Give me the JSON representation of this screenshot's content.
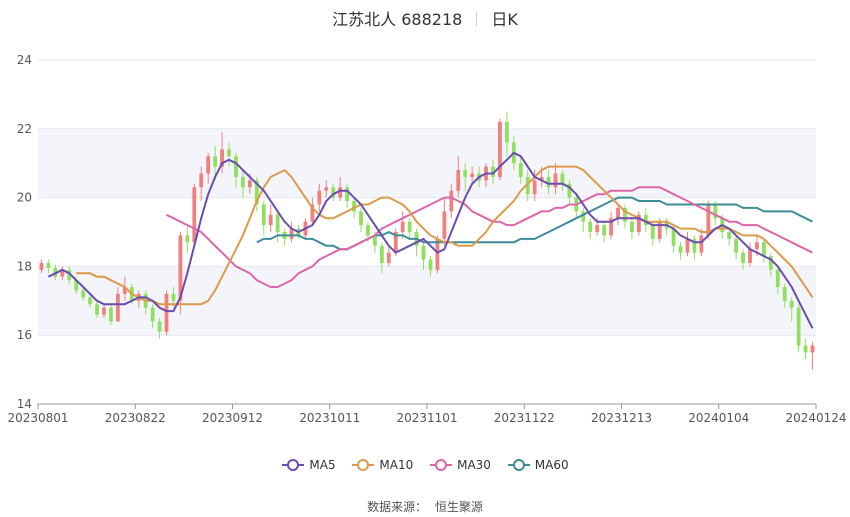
{
  "title": {
    "name": "江苏北人 688218",
    "period": "日K"
  },
  "source": {
    "label": "数据来源：",
    "provider": "恒生聚源"
  },
  "chart_data": {
    "type": "candlestick",
    "ylim": [
      14,
      24
    ],
    "yticks": [
      "14",
      "16",
      "18",
      "20",
      "22",
      "24"
    ],
    "xticks": [
      "20230801",
      "20230822",
      "20230912",
      "20231011",
      "20231101",
      "20231122",
      "20231213",
      "20240104",
      "20240124"
    ],
    "up_color": "#f08080",
    "down_color": "#90e060",
    "grid_band_color": "#f3f5fa",
    "legend": [
      {
        "name": "MA5",
        "color": "#6b4cb0"
      },
      {
        "name": "MA10",
        "color": "#dd9a4a"
      },
      {
        "name": "MA30",
        "color": "#dd66aa"
      },
      {
        "name": "MA60",
        "color": "#3c8e96"
      }
    ],
    "candles": [
      [
        17.9,
        18.1,
        17.8,
        18.2
      ],
      [
        18.1,
        17.95,
        17.8,
        18.2
      ],
      [
        17.95,
        17.7,
        17.6,
        18.05
      ],
      [
        17.7,
        17.9,
        17.6,
        18.0
      ],
      [
        17.9,
        17.6,
        17.5,
        18.0
      ],
      [
        17.6,
        17.3,
        17.2,
        17.7
      ],
      [
        17.3,
        17.1,
        17.0,
        17.4
      ],
      [
        17.1,
        16.9,
        16.8,
        17.2
      ],
      [
        16.9,
        16.6,
        16.5,
        17.0
      ],
      [
        16.6,
        16.8,
        16.5,
        16.9
      ],
      [
        16.8,
        16.4,
        16.3,
        16.9
      ],
      [
        16.4,
        17.2,
        16.4,
        17.4
      ],
      [
        17.2,
        17.4,
        17.0,
        17.7
      ],
      [
        17.4,
        17.0,
        16.9,
        17.5
      ],
      [
        17.0,
        17.2,
        16.8,
        17.3
      ],
      [
        17.2,
        16.8,
        16.6,
        17.3
      ],
      [
        16.8,
        16.4,
        16.2,
        16.9
      ],
      [
        16.4,
        16.1,
        15.9,
        16.5
      ],
      [
        16.1,
        17.2,
        16.0,
        17.3
      ],
      [
        17.2,
        17.0,
        16.8,
        17.4
      ],
      [
        17.0,
        18.9,
        16.6,
        19.0
      ],
      [
        18.9,
        18.7,
        18.4,
        19.2
      ],
      [
        18.7,
        20.3,
        18.6,
        20.4
      ],
      [
        20.3,
        20.7,
        19.9,
        20.9
      ],
      [
        20.7,
        21.2,
        20.4,
        21.3
      ],
      [
        21.2,
        20.9,
        20.5,
        21.5
      ],
      [
        20.9,
        21.4,
        20.7,
        21.9
      ],
      [
        21.4,
        21.2,
        20.9,
        21.6
      ],
      [
        21.2,
        20.6,
        20.3,
        21.3
      ],
      [
        20.6,
        20.3,
        20.0,
        20.8
      ],
      [
        20.3,
        20.5,
        20.1,
        20.7
      ],
      [
        20.5,
        19.8,
        19.6,
        20.6
      ],
      [
        19.8,
        19.2,
        18.9,
        19.9
      ],
      [
        19.2,
        19.5,
        19.0,
        19.8
      ],
      [
        19.5,
        19.0,
        18.7,
        19.6
      ],
      [
        19.0,
        18.8,
        18.6,
        19.1
      ],
      [
        18.8,
        19.1,
        18.7,
        19.3
      ],
      [
        19.1,
        18.9,
        18.8,
        19.2
      ],
      [
        18.9,
        19.3,
        18.8,
        19.4
      ],
      [
        19.3,
        19.8,
        19.2,
        20.0
      ],
      [
        19.8,
        20.2,
        19.6,
        20.4
      ],
      [
        20.2,
        20.3,
        20.0,
        20.5
      ],
      [
        20.3,
        20.0,
        19.9,
        20.4
      ],
      [
        20.0,
        20.3,
        19.9,
        20.6
      ],
      [
        20.3,
        19.9,
        19.7,
        20.4
      ],
      [
        19.9,
        19.6,
        19.4,
        20.0
      ],
      [
        19.6,
        19.2,
        19.0,
        19.7
      ],
      [
        19.2,
        18.9,
        18.7,
        19.3
      ],
      [
        18.9,
        18.6,
        18.4,
        19.0
      ],
      [
        18.6,
        18.1,
        17.8,
        18.7
      ],
      [
        18.1,
        18.4,
        18.0,
        18.6
      ],
      [
        18.4,
        19.0,
        18.3,
        19.1
      ],
      [
        19.0,
        19.3,
        18.8,
        19.6
      ],
      [
        19.3,
        19.0,
        18.8,
        19.4
      ],
      [
        19.0,
        18.6,
        18.3,
        19.1
      ],
      [
        18.6,
        18.2,
        17.9,
        18.7
      ],
      [
        18.2,
        17.9,
        17.7,
        18.3
      ],
      [
        17.9,
        18.8,
        17.8,
        18.9
      ],
      [
        18.8,
        19.6,
        18.6,
        20.0
      ],
      [
        19.6,
        20.2,
        19.4,
        20.4
      ],
      [
        20.2,
        20.8,
        20.0,
        21.2
      ],
      [
        20.8,
        20.6,
        20.2,
        21.0
      ],
      [
        20.6,
        20.7,
        20.4,
        20.9
      ],
      [
        20.7,
        20.5,
        20.3,
        20.9
      ],
      [
        20.5,
        20.9,
        20.3,
        21.0
      ],
      [
        20.9,
        20.6,
        20.4,
        21.1
      ],
      [
        20.6,
        22.2,
        20.5,
        22.3
      ],
      [
        22.2,
        21.6,
        21.2,
        22.5
      ],
      [
        21.6,
        21.0,
        20.8,
        21.8
      ],
      [
        21.0,
        20.6,
        20.4,
        21.2
      ],
      [
        20.6,
        20.1,
        19.9,
        20.8
      ],
      [
        20.1,
        20.5,
        19.9,
        20.8
      ],
      [
        20.5,
        20.6,
        20.3,
        20.9
      ],
      [
        20.6,
        20.3,
        20.1,
        20.8
      ],
      [
        20.3,
        20.7,
        20.1,
        21.0
      ],
      [
        20.7,
        20.4,
        20.2,
        20.8
      ],
      [
        20.4,
        20.0,
        19.8,
        20.5
      ],
      [
        20.0,
        19.6,
        19.4,
        20.1
      ],
      [
        19.6,
        19.3,
        19.0,
        19.7
      ],
      [
        19.3,
        19.0,
        18.8,
        19.4
      ],
      [
        19.0,
        19.2,
        18.9,
        19.4
      ],
      [
        19.2,
        18.9,
        18.7,
        19.3
      ],
      [
        18.9,
        19.4,
        18.8,
        19.6
      ],
      [
        19.4,
        19.7,
        19.2,
        19.8
      ],
      [
        19.7,
        19.3,
        19.1,
        19.8
      ],
      [
        19.3,
        19.0,
        18.8,
        19.4
      ],
      [
        19.0,
        19.5,
        18.9,
        19.6
      ],
      [
        19.5,
        19.2,
        19.0,
        19.7
      ],
      [
        19.2,
        18.8,
        18.6,
        19.3
      ],
      [
        18.8,
        19.3,
        18.7,
        19.4
      ],
      [
        19.3,
        19.1,
        18.9,
        19.4
      ],
      [
        19.1,
        18.6,
        18.4,
        19.2
      ],
      [
        18.6,
        18.4,
        18.2,
        18.7
      ],
      [
        18.4,
        18.8,
        18.3,
        19.0
      ],
      [
        18.8,
        18.4,
        18.2,
        18.9
      ],
      [
        18.4,
        18.9,
        18.3,
        19.1
      ],
      [
        18.9,
        19.8,
        18.8,
        19.9
      ],
      [
        19.8,
        19.4,
        19.2,
        19.9
      ],
      [
        19.4,
        19.0,
        18.8,
        19.5
      ],
      [
        19.0,
        18.8,
        18.6,
        19.1
      ],
      [
        18.8,
        18.4,
        18.2,
        18.9
      ],
      [
        18.4,
        18.1,
        17.9,
        18.5
      ],
      [
        18.1,
        18.5,
        18.0,
        18.7
      ],
      [
        18.5,
        18.7,
        18.3,
        18.9
      ],
      [
        18.7,
        18.3,
        18.1,
        18.8
      ],
      [
        18.3,
        17.9,
        17.7,
        18.4
      ],
      [
        17.9,
        17.4,
        17.2,
        18.0
      ],
      [
        17.4,
        17.0,
        16.8,
        17.5
      ],
      [
        17.0,
        16.8,
        16.4,
        17.1
      ],
      [
        16.8,
        15.7,
        15.5,
        16.9
      ],
      [
        15.7,
        15.5,
        15.3,
        15.9
      ],
      [
        15.5,
        15.7,
        15.0,
        15.8
      ]
    ],
    "ma5": [
      17.7,
      17.8,
      17.9,
      17.8,
      17.6,
      17.4,
      17.2,
      17.0,
      16.9,
      16.9,
      16.9,
      16.9,
      17.0,
      17.1,
      17.1,
      17.0,
      16.8,
      16.7,
      16.7,
      17.1,
      17.8,
      18.6,
      19.4,
      20.1,
      20.6,
      21.0,
      21.1,
      21.0,
      20.8,
      20.6,
      20.4,
      20.2,
      19.9,
      19.6,
      19.3,
      19.1,
      19.0,
      19.1,
      19.2,
      19.5,
      19.9,
      20.1,
      20.2,
      20.2,
      20.0,
      19.8,
      19.5,
      19.2,
      18.9,
      18.6,
      18.4,
      18.5,
      18.6,
      18.7,
      18.8,
      18.6,
      18.4,
      18.5,
      19.0,
      19.5,
      20.0,
      20.4,
      20.6,
      20.7,
      20.7,
      20.9,
      21.1,
      21.3,
      21.2,
      20.9,
      20.6,
      20.5,
      20.4,
      20.4,
      20.4,
      20.3,
      20.1,
      19.8,
      19.5,
      19.3,
      19.3,
      19.3,
      19.4,
      19.4,
      19.4,
      19.4,
      19.3,
      19.2,
      19.2,
      19.2,
      19.1,
      18.9,
      18.8,
      18.7,
      18.7,
      18.9,
      19.1,
      19.2,
      19.1,
      18.9,
      18.7,
      18.5,
      18.4,
      18.3,
      18.2,
      18.0,
      17.7,
      17.4,
      17.0,
      16.6,
      16.2
    ],
    "ma10": [
      17.8,
      17.8,
      17.8,
      17.7,
      17.7,
      17.6,
      17.5,
      17.4,
      17.2,
      17.1,
      17.0,
      17.0,
      16.9,
      16.9,
      16.9,
      16.9,
      16.9,
      16.9,
      16.9,
      17.0,
      17.3,
      17.7,
      18.1,
      18.5,
      18.9,
      19.4,
      19.9,
      20.3,
      20.6,
      20.7,
      20.8,
      20.6,
      20.3,
      20.0,
      19.7,
      19.5,
      19.4,
      19.4,
      19.5,
      19.6,
      19.7,
      19.8,
      19.8,
      19.9,
      20.0,
      20.0,
      19.9,
      19.8,
      19.6,
      19.3,
      19.1,
      18.9,
      18.8,
      18.7,
      18.7,
      18.6,
      18.6,
      18.6,
      18.8,
      19.0,
      19.3,
      19.5,
      19.7,
      19.9,
      20.2,
      20.4,
      20.6,
      20.8,
      20.9,
      20.9,
      20.9,
      20.9,
      20.9,
      20.8,
      20.6,
      20.4,
      20.2,
      20.0,
      19.8,
      19.6,
      19.5,
      19.4,
      19.3,
      19.3,
      19.3,
      19.3,
      19.2,
      19.1,
      19.1,
      19.1,
      19.0,
      19.0,
      19.1,
      19.1,
      19.1,
      19.0,
      18.9,
      18.9,
      18.9,
      18.8,
      18.6,
      18.4,
      18.2,
      18.0,
      17.7,
      17.4,
      17.1
    ],
    "ma30": [
      19.5,
      19.4,
      19.3,
      19.2,
      19.1,
      19.0,
      18.8,
      18.6,
      18.4,
      18.2,
      18.0,
      17.9,
      17.8,
      17.6,
      17.5,
      17.4,
      17.4,
      17.5,
      17.6,
      17.8,
      17.9,
      18.0,
      18.2,
      18.3,
      18.4,
      18.5,
      18.5,
      18.6,
      18.7,
      18.8,
      18.9,
      19.1,
      19.2,
      19.3,
      19.4,
      19.5,
      19.6,
      19.7,
      19.8,
      19.9,
      20.0,
      20.0,
      19.9,
      19.8,
      19.6,
      19.5,
      19.4,
      19.3,
      19.3,
      19.2,
      19.2,
      19.3,
      19.4,
      19.5,
      19.6,
      19.6,
      19.7,
      19.7,
      19.8,
      19.8,
      19.9,
      20.0,
      20.1,
      20.1,
      20.2,
      20.2,
      20.2,
      20.2,
      20.3,
      20.3,
      20.3,
      20.3,
      20.2,
      20.1,
      20.0,
      19.9,
      19.8,
      19.7,
      19.6,
      19.5,
      19.4,
      19.3,
      19.3,
      19.2,
      19.2,
      19.2,
      19.1,
      19.0,
      18.9,
      18.8,
      18.7,
      18.6,
      18.5,
      18.4
    ],
    "ma60": [
      18.7,
      18.8,
      18.8,
      18.9,
      18.9,
      18.9,
      18.9,
      18.8,
      18.8,
      18.7,
      18.6,
      18.6,
      18.5,
      18.5,
      18.6,
      18.7,
      18.8,
      18.9,
      18.9,
      19.0,
      18.9,
      18.9,
      18.8,
      18.8,
      18.7,
      18.7,
      18.7,
      18.7,
      18.7,
      18.7,
      18.7,
      18.7,
      18.7,
      18.7,
      18.7,
      18.7,
      18.7,
      18.7,
      18.8,
      18.8,
      18.8,
      18.9,
      19.0,
      19.1,
      19.2,
      19.3,
      19.4,
      19.5,
      19.6,
      19.7,
      19.8,
      19.9,
      20.0,
      20.0,
      20.0,
      19.9,
      19.9,
      19.9,
      19.9,
      19.8,
      19.8,
      19.8,
      19.8,
      19.8,
      19.8,
      19.8,
      19.8,
      19.8,
      19.8,
      19.8,
      19.7,
      19.7,
      19.7,
      19.6,
      19.6,
      19.6,
      19.6,
      19.6,
      19.5,
      19.4,
      19.3
    ]
  }
}
